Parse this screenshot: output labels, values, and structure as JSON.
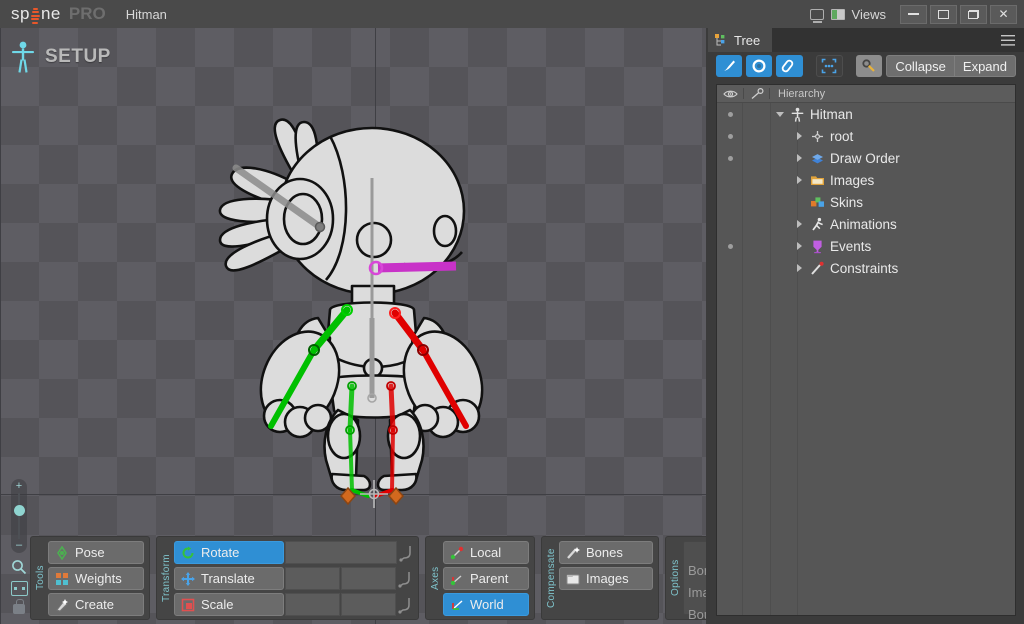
{
  "app": {
    "brand_sp": "sp",
    "brand_ne": "ne",
    "brand_pro": "PRO",
    "project_name": "Hitman",
    "accent_orange": "#e8572a",
    "accent_blue": "#2f8fd4",
    "panel_bg": "#3b3b3b",
    "titlebar_bg": "#4a4a4a"
  },
  "titlebar": {
    "views_label": "Views",
    "monitor_icon": "monitor-icon",
    "layout_icon": "layout-icon",
    "minimize_label": "Minimize",
    "maximize_label": "Maximize",
    "restore_label": "Restore",
    "close_label": "✕"
  },
  "viewport": {
    "mode_label": "SETUP",
    "mode_icon": "skeleton-figure-icon",
    "zoom": {
      "plus": "+",
      "minus": "–",
      "magnifier_icon": "magnifier-icon",
      "fit_icon": "fit-to-view-icon",
      "lock_icon": "lock-icon"
    },
    "skeleton": {
      "name": "Hitman",
      "selected_bone_color": "#c832c8",
      "left_bone_color": "#00c000",
      "right_bone_color": "#e00000",
      "inactive_bone_color": "#8c8c8c",
      "foot_marker_color": "#d2691e"
    }
  },
  "toolbar": {
    "tools": {
      "label": "Tools",
      "items": [
        {
          "label": "Pose",
          "icon": "pose-icon",
          "active": false
        },
        {
          "label": "Weights",
          "icon": "weights-icon",
          "active": false
        },
        {
          "label": "Create",
          "icon": "create-icon",
          "active": false
        }
      ]
    },
    "transform": {
      "label": "Transform",
      "items": [
        {
          "label": "Rotate",
          "icon": "rotate-icon",
          "active": true
        },
        {
          "label": "Translate",
          "icon": "translate-icon",
          "active": false
        },
        {
          "label": "Scale",
          "icon": "scale-icon",
          "active": false
        }
      ]
    },
    "axes": {
      "label": "Axes",
      "items": [
        {
          "label": "Local",
          "icon": "axes-local-icon",
          "active": false
        },
        {
          "label": "Parent",
          "icon": "axes-parent-icon",
          "active": false
        },
        {
          "label": "World",
          "icon": "axes-world-icon",
          "active": true
        }
      ]
    },
    "compensate": {
      "label": "Compensate",
      "items": [
        {
          "label": "Bones",
          "icon": "bones-icon",
          "active": false
        },
        {
          "label": "Images",
          "icon": "images-icon",
          "active": false
        }
      ]
    },
    "options": {
      "label": "Options",
      "columns": [
        "cursor-icon",
        "eye-icon",
        "rotate-arrow-icon"
      ],
      "rows": [
        {
          "label": "Bones",
          "dots": [
            true,
            true
          ]
        },
        {
          "label": "Images",
          "dots": [
            true,
            true
          ]
        },
        {
          "label": "Bounds",
          "dots": [
            true,
            true
          ]
        }
      ]
    }
  },
  "tree_panel": {
    "tab_label": "Tree",
    "tab_icon": "tree-icon",
    "menu_icon": "hamburger-icon",
    "toolbar_buttons": [
      {
        "icon": "brush-icon",
        "state": "active"
      },
      {
        "icon": "circle-icon",
        "state": "active"
      },
      {
        "icon": "attachment-icon",
        "state": "active"
      },
      {
        "icon": "focus-icon",
        "state": "dark"
      },
      {
        "icon": "key-icon",
        "state": "gray"
      }
    ],
    "collapse_label": "Collapse",
    "expand_label": "Expand",
    "header": {
      "eye_icon": "eye-icon",
      "key_icon": "key-icon",
      "name_label": "Hierarchy"
    },
    "items": [
      {
        "label": "Hitman",
        "icon": "skeleton-icon",
        "indent": 0,
        "expander": "open",
        "dot": true
      },
      {
        "label": "root",
        "icon": "bone-root-icon",
        "indent": 1,
        "expander": "closed",
        "dot": true
      },
      {
        "label": "Draw Order",
        "icon": "draw-order-icon",
        "indent": 1,
        "expander": "closed",
        "dot": true
      },
      {
        "label": "Images",
        "icon": "folder-icon",
        "indent": 1,
        "expander": "closed",
        "dot": false
      },
      {
        "label": "Skins",
        "icon": "skins-icon",
        "indent": 1,
        "expander": "none",
        "dot": false
      },
      {
        "label": "Animations",
        "icon": "animation-icon",
        "indent": 1,
        "expander": "closed",
        "dot": false
      },
      {
        "label": "Events",
        "icon": "event-icon",
        "indent": 1,
        "expander": "closed",
        "dot": true
      },
      {
        "label": "Constraints",
        "icon": "constraint-icon",
        "indent": 1,
        "expander": "closed",
        "dot": false
      }
    ]
  }
}
